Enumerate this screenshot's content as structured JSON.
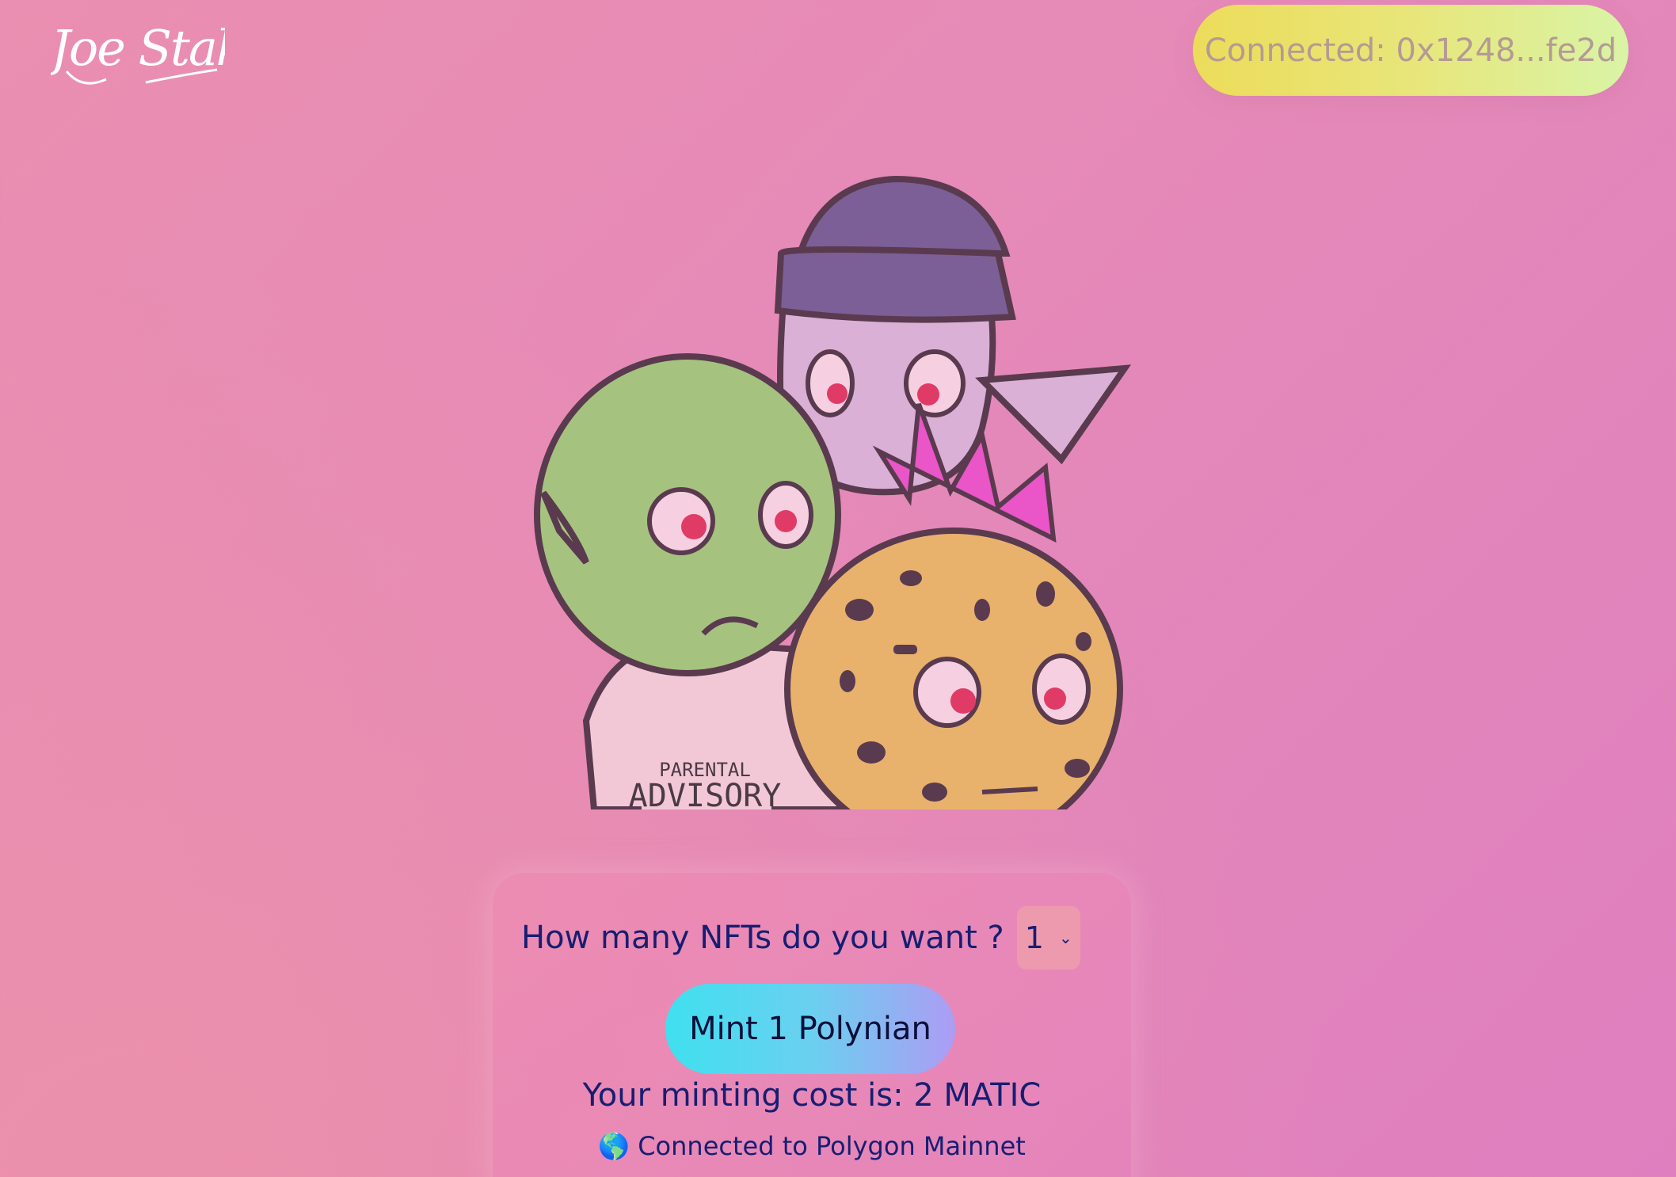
{
  "header": {
    "logo_text": "Joe Stakey",
    "connect_button_label": "Connected: 0x1248...fe2d"
  },
  "hero": {
    "shirt_text_line1": "PARENTAL",
    "shirt_text_line2": "ADVISORY"
  },
  "mint_panel": {
    "quantity_label": "How many NFTs do you want ?",
    "quantity_selected": "1",
    "mint_button_label": "Mint 1 Polynian",
    "cost_text": "Your minting cost is: 2 MATIC",
    "network_text": "🌎 Connected to Polygon Mainnet"
  },
  "colors": {
    "text_navy": "#161e72",
    "connect_button_gradient": [
      "#ecdc5a",
      "#d9f4a6"
    ],
    "mint_button_gradient": [
      "#3fe0ef",
      "#ad9cf4"
    ]
  }
}
